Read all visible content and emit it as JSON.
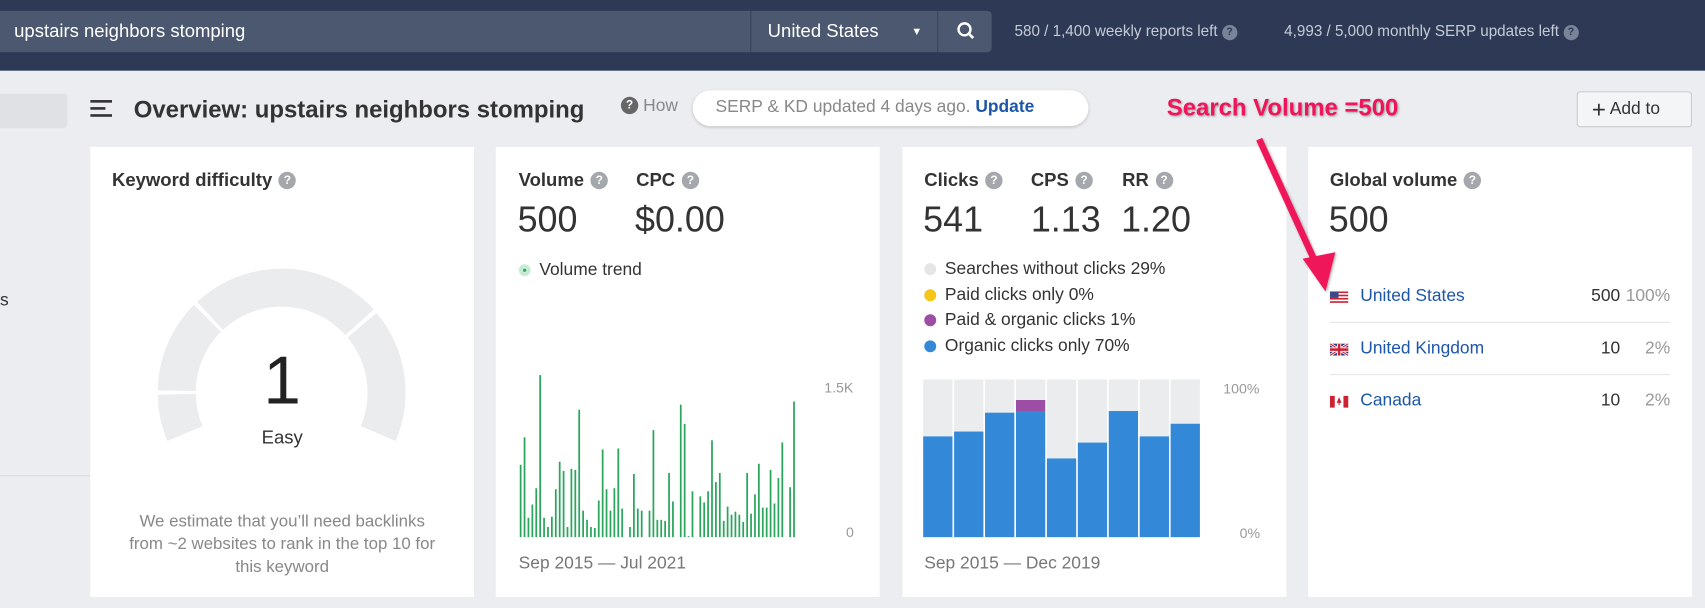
{
  "topbar": {
    "search_value": "upstairs neighbors stomping",
    "country": "United States",
    "weekly_reports": "580 / 1,400 weekly reports left",
    "serp_updates": "4,993 / 5,000 monthly SERP updates left"
  },
  "header": {
    "title": "Overview: upstairs neighbors stomping",
    "how": "How",
    "notice": "SERP & KD updated 4 days ago.",
    "update_link": "Update",
    "add_to": "Add to",
    "sidebar_fragment": "s"
  },
  "annotation": {
    "text": "Search Volume =500",
    "color": "#f0145a"
  },
  "kd": {
    "title": "Keyword difficulty",
    "value": "1",
    "label": "Easy",
    "description": "We estimate that you’ll need backlinks from ~2 websites to rank in the top 10 for this keyword"
  },
  "volume": {
    "title": "Volume",
    "value": "500",
    "cpc_title": "CPC",
    "cpc_value": "$0.00",
    "legend": "Volume trend",
    "y_max_label": "1.5K",
    "y_min_label": "0",
    "range": "Sep 2015 — Jul 2021"
  },
  "clicks": {
    "title": "Clicks",
    "value": "541",
    "cps_title": "CPS",
    "cps_value": "1.13",
    "rr_title": "RR",
    "rr_value": "1.20",
    "legend": [
      {
        "label": "Searches without clicks 29%",
        "color": "#e6e6e6"
      },
      {
        "label": "Paid clicks only 0%",
        "color": "#f5c518"
      },
      {
        "label": "Paid & organic clicks 1%",
        "color": "#9b4ea3"
      },
      {
        "label": "Organic clicks only 70%",
        "color": "#3388d8"
      }
    ],
    "y_max_label": "100%",
    "y_min_label": "0%",
    "range": "Sep 2015 — Dec 2019"
  },
  "global": {
    "title": "Global volume",
    "value": "500",
    "countries": [
      {
        "name": "United States",
        "volume": "500",
        "share": "100%",
        "flag": "us-flag"
      },
      {
        "name": "United Kingdom",
        "volume": "10",
        "share": "2%",
        "flag": "uk-flag"
      },
      {
        "name": "Canada",
        "volume": "10",
        "share": "2%",
        "flag": "ca-flag"
      }
    ]
  },
  "chart_data": [
    {
      "type": "bar",
      "title": "Volume trend",
      "color": "#2aa65c",
      "x_range": [
        "Sep 2015",
        "Jul 2021"
      ],
      "ylim": [
        0,
        1600
      ],
      "y_ticks": [
        "0",
        "1.5K"
      ],
      "values": [
        710,
        980,
        190,
        320,
        480,
        1590,
        190,
        100,
        200,
        470,
        740,
        650,
        100,
        670,
        660,
        1250,
        260,
        170,
        100,
        90,
        360,
        860,
        470,
        260,
        480,
        870,
        280,
        0,
        100,
        620,
        280,
        260,
        0,
        260,
        1050,
        170,
        170,
        160,
        630,
        350,
        0,
        1300,
        1110,
        10,
        450,
        0,
        400,
        340,
        450,
        950,
        540,
        630,
        160,
        300,
        220,
        250,
        220,
        150,
        630,
        230,
        420,
        720,
        290,
        290,
        660,
        330,
        580,
        930,
        0,
        490,
        1330
      ]
    },
    {
      "type": "bar",
      "stacked": true,
      "title": "",
      "x_range": [
        "Sep 2015",
        "Dec 2019"
      ],
      "ylim": [
        0,
        100
      ],
      "y_ticks": [
        "0%",
        "100%"
      ],
      "series": [
        {
          "name": "Organic clicks only",
          "color": "#3388d8",
          "values": [
            64,
            67,
            79,
            80,
            50,
            60,
            80,
            64,
            72
          ]
        },
        {
          "name": "Paid & organic clicks",
          "color": "#9b4ea3",
          "values": [
            0,
            0,
            0,
            7,
            0,
            0,
            0,
            0,
            0
          ]
        },
        {
          "name": "Searches without clicks",
          "color": "#ebecee",
          "values": [
            36,
            33,
            21,
            13,
            50,
            40,
            20,
            36,
            28
          ]
        }
      ]
    }
  ]
}
